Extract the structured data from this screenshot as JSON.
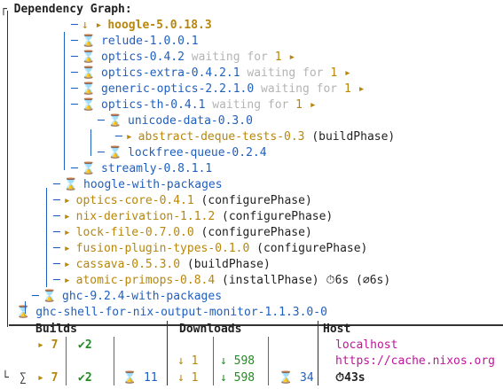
{
  "header": "Dependency Graph:",
  "nodes": [
    {
      "indent": "    ────",
      "state": "downloading",
      "name": "hoogle-5.0.18.3"
    },
    {
      "indent": "    │   ",
      "state": "planned",
      "name": "relude-1.0.0.1"
    },
    {
      "indent": "    │   ",
      "state": "waiting",
      "name": "optics-0.4.2",
      "waiting": "waiting for",
      "n": "1"
    },
    {
      "indent": "    │   ",
      "state": "waiting",
      "name": "optics-extra-0.4.2.1",
      "waiting": "waiting for",
      "n": "1"
    },
    {
      "indent": "    │   ",
      "state": "waiting",
      "name": "generic-optics-2.2.1.0",
      "waiting": "waiting for",
      "n": "1"
    },
    {
      "indent": "    │   ",
      "state": "waiting",
      "name": "optics-th-0.4.1",
      "waiting": "waiting for",
      "n": "1"
    },
    {
      "indent": "    │     ┌─",
      "state": "planned",
      "name": "unicode-data-0.3.0"
    },
    {
      "indent": "    │     │  ┌─",
      "state": "building",
      "name": "abstract-deque-tests-0.3",
      "phase": "(buildPhase)"
    },
    {
      "indent": "    │     └─",
      "state": "planned",
      "name": "lockfree-queue-0.2.4"
    },
    {
      "indent": "    └─",
      "state": "planned",
      "name": "streamly-0.8.1.1"
    },
    {
      "indent": "  ┌─",
      "state": "planned",
      "name": "hoogle-with-packages"
    },
    {
      "indent": "  ├─",
      "state": "building",
      "name": "optics-core-0.4.1",
      "phase": "(configurePhase)"
    },
    {
      "indent": "  ├─",
      "state": "building",
      "name": "nix-derivation-1.1.2",
      "phase": "(configurePhase)"
    },
    {
      "indent": "  ├─",
      "state": "building",
      "name": "lock-file-0.7.0.0",
      "phase": "(configurePhase)"
    },
    {
      "indent": "  ├─",
      "state": "building",
      "name": "fusion-plugin-types-0.1.0",
      "phase": "(configurePhase)"
    },
    {
      "indent": "  ├─",
      "state": "building",
      "name": "cassava-0.5.3.0",
      "phase": "(buildPhase)"
    },
    {
      "indent": "  ├─",
      "state": "building",
      "name": "atomic-primops-0.8.4",
      "phase": "(installPhase)",
      "timer": "⏱6s",
      "avg": "(∅6s)"
    },
    {
      "indent": " ├─",
      "state": "planned",
      "name": "ghc-9.2.4-with-packages"
    },
    {
      "indent": "",
      "state": "planned",
      "name": "ghc-shell-for-nix-output-monitor-1.1.3.0-0"
    }
  ],
  "table": {
    "headers": {
      "builds": "Builds",
      "downloads": "Downloads",
      "host": "Host"
    },
    "row1": {
      "running": "▸ 7",
      "done": "✔2",
      "dl_running": "↓ 1",
      "dl_done": "↓ 598",
      "host": "localhost"
    },
    "row2": {
      "host": "https://cache.nixos.org"
    },
    "sum": {
      "sigma": "∑",
      "running": "▸ 7",
      "done": "✔2",
      "planned": "⌛ 11",
      "dl_running": "↓ 1",
      "dl_done": "↓ 598",
      "dl_planned": "⌛ 34",
      "time": "⏱43s"
    }
  },
  "colors": {
    "blue": "#1f5fbf",
    "gold": "#b8860b",
    "green": "#1f8f1f",
    "grey": "#b4b4b4",
    "magenta": "#c0149c"
  }
}
